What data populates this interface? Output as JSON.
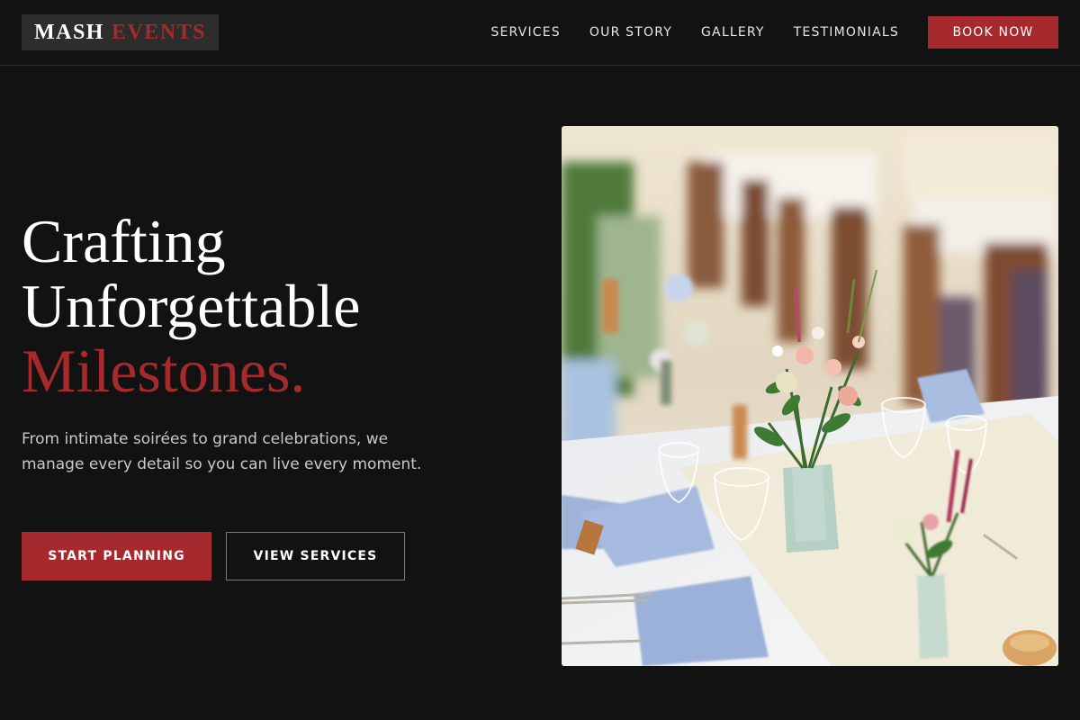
{
  "brand": {
    "name_part1": "MASH",
    "name_part2": "EVENTS",
    "accent_color": "#a62a2d"
  },
  "nav": {
    "links": [
      "SERVICES",
      "OUR STORY",
      "GALLERY",
      "TESTIMONIALS"
    ],
    "cta_label": "BOOK NOW"
  },
  "hero": {
    "title_line1": "Crafting",
    "title_line2": "Unforgettable",
    "title_accent": "Milestones.",
    "subtitle": "From intimate soirées to grand celebrations, we manage every detail so you can live every moment.",
    "primary_button": "START PLANNING",
    "secondary_button": "VIEW SERVICES"
  },
  "image": {
    "subject": "wedding-table-flowers"
  }
}
